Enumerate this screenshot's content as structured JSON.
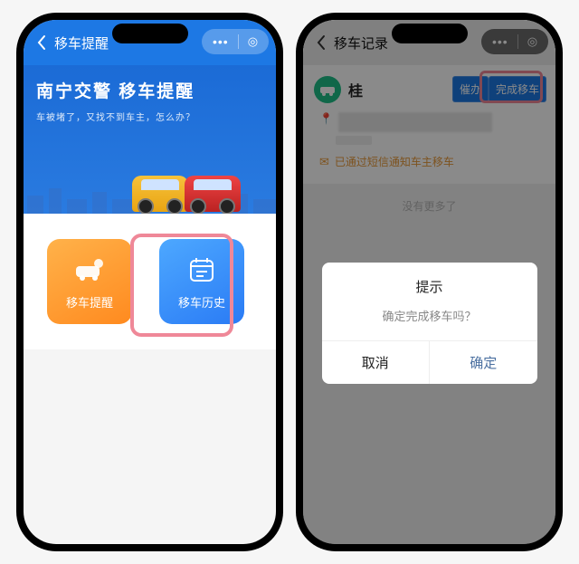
{
  "left": {
    "nav": {
      "title": "移车提醒"
    },
    "hero": {
      "title": "南宁交警 移车提醒",
      "subtitle": "车被堵了，又找不到车主，怎么办？"
    },
    "tiles": {
      "reminder": {
        "label": "移车提醒",
        "icon": "car-icon"
      },
      "history": {
        "label": "移车历史",
        "icon": "calendar-icon"
      }
    }
  },
  "right": {
    "nav": {
      "title": "移车记录"
    },
    "record": {
      "plate": "桂",
      "urge_label": "催办",
      "done_label": "完成移车",
      "sms_status": "已通过短信通知车主移车",
      "no_more": "没有更多了"
    },
    "dialog": {
      "title": "提示",
      "message": "确定完成移车吗？",
      "cancel": "取消",
      "ok": "确定"
    }
  }
}
